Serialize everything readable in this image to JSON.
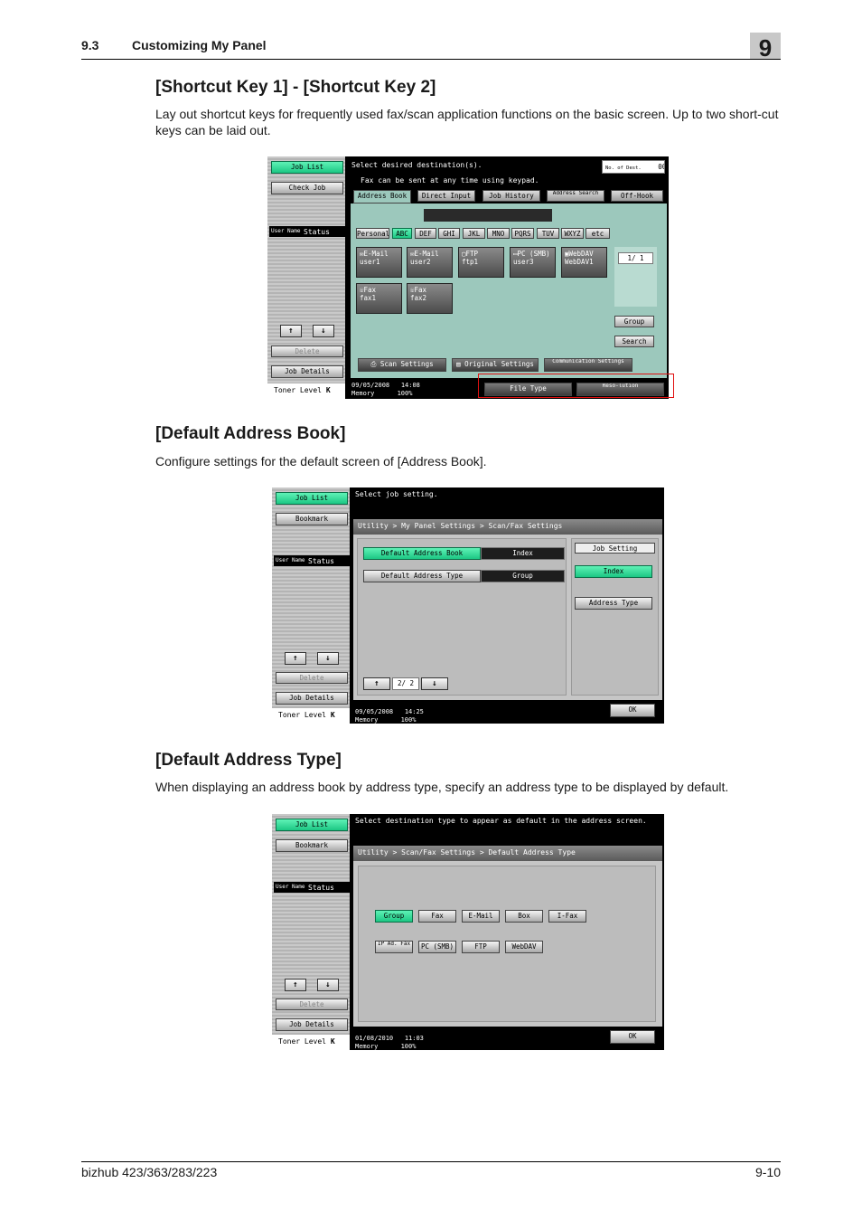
{
  "header": {
    "section_num": "9.3",
    "section_title": "Customizing My Panel",
    "chapter": "9"
  },
  "sections": [
    {
      "title": "[Shortcut Key 1] - [Shortcut Key 2]",
      "body": "Lay out shortcut keys for frequently used fax/scan application functions on the basic screen. Up to two short-cut keys can be laid out."
    },
    {
      "title": "[Default Address Book]",
      "body": "Configure settings for the default screen of [Address Book]."
    },
    {
      "title": "[Default Address Type]",
      "body": "When displaying an address book by address type, specify an address type to be displayed by default."
    }
  ],
  "footer": {
    "model": "bizhub 423/363/283/223",
    "page": "9-10"
  },
  "left_panel": {
    "job_list": "Job List",
    "check_job": "Check Job",
    "bookmark": "Bookmark",
    "user_name": "User Name",
    "status": "Status",
    "up": "↑",
    "down": "↓",
    "delete": "Delete",
    "job_details": "Job Details",
    "toner": "Toner Level",
    "toner_k": "K"
  },
  "screen1": {
    "msg1": "Select desired destination(s).",
    "msg2": "Fax can be sent at any time using keypad.",
    "no_of_dest_label": "No. of Dest.",
    "no_of_dest_value": "000",
    "tabs": [
      "Address Book",
      "Direct Input",
      "Job History",
      "Address Search",
      "Off-Hook"
    ],
    "index_tabs": [
      "Personal",
      "ABC",
      "DEF",
      "GHI",
      "JKL",
      "MNO",
      "PQRS",
      "TUV",
      "WXYZ",
      "etc"
    ],
    "destinations": [
      {
        "type": "E-Mail",
        "name": "user1"
      },
      {
        "type": "E-Mail",
        "name": "user2"
      },
      {
        "type": "FTP",
        "name": "ftp1"
      },
      {
        "type": "PC (SMB)",
        "name": "user3"
      },
      {
        "type": "WebDAV",
        "name": "WebDAV1"
      },
      {
        "type": "Fax",
        "name": "fax1"
      },
      {
        "type": "Fax",
        "name": "fax2"
      }
    ],
    "page_indicator": "1/ 1",
    "group": "Group",
    "search": "Search",
    "bottom_tabs": [
      "Scan Settings",
      "Original Settings",
      "Communication Settings"
    ],
    "date": "09/05/2008",
    "time": "14:08",
    "memory": "Memory",
    "memory_pct": "100%",
    "shortcut_keys": [
      "File Type",
      "Reso-lution"
    ]
  },
  "screen2": {
    "msg": "Select job setting.",
    "breadcrumb": "Utility > My Panel Settings > Scan/Fax Settings",
    "rows": [
      {
        "label": "Default Address Book",
        "value": "Index"
      },
      {
        "label": "Default Address Type",
        "value": "Group"
      }
    ],
    "pager": "2/ 2",
    "job_setting": "Job Setting",
    "options": [
      "Index",
      "Address Type"
    ],
    "date": "09/05/2008",
    "time": "14:25",
    "memory": "Memory",
    "memory_pct": "100%",
    "ok": "OK"
  },
  "screen3": {
    "msg": "Select destination type to appear as default in the address screen.",
    "breadcrumb": "Utility > Scan/Fax Settings > Default Address Type",
    "types_row1": [
      "Group",
      "Fax",
      "E-Mail",
      "Box",
      "I-Fax"
    ],
    "types_row2": [
      "IP Ad. Fax",
      "PC (SMB)",
      "FTP",
      "WebDAV"
    ],
    "date": "01/08/2010",
    "time": "11:03",
    "memory": "Memory",
    "memory_pct": "100%",
    "ok": "OK"
  },
  "colors": {
    "selected_green": "#22d08a",
    "panel_teal": "#9cc8bc",
    "highlight_red": "#e01010"
  }
}
